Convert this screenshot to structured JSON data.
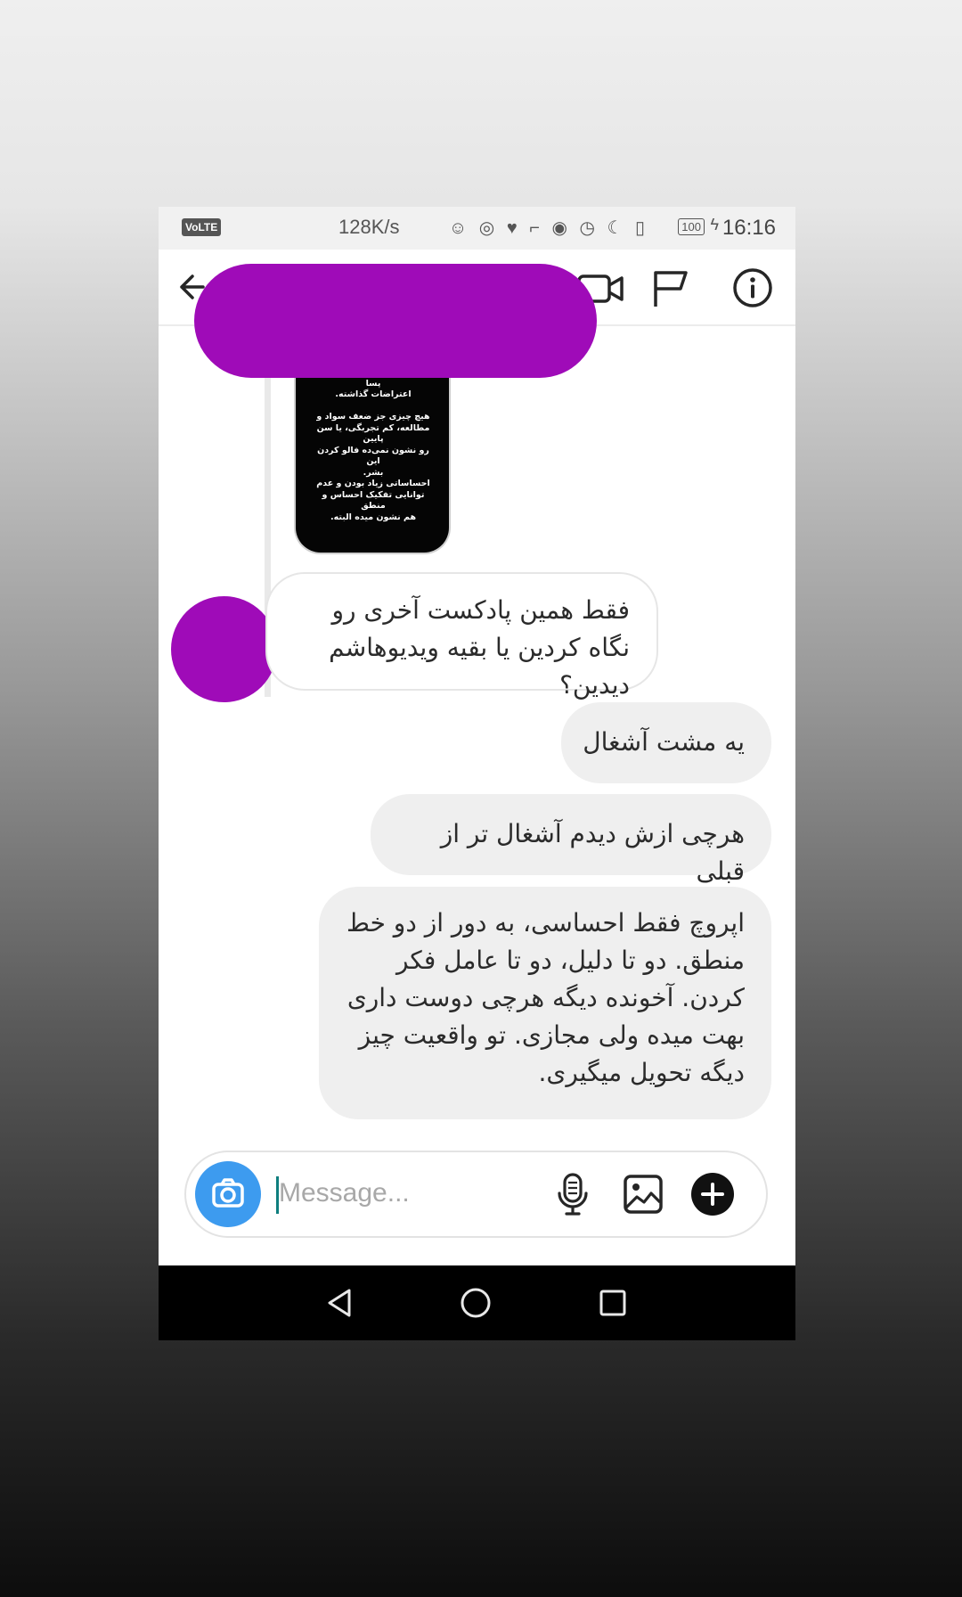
{
  "status_bar": {
    "volte": "VoLTE",
    "speed": "128K/s",
    "battery": "100",
    "time": "16:16"
  },
  "header": {
    "icons": [
      "back-arrow-icon",
      "video-call-icon",
      "flag-icon",
      "info-icon"
    ]
  },
  "story": {
    "text": "بعد استوری باز می‌کنم طرف از\nحسن آقا میری روضه خوونی پسا\nاعتراضات گذاشته.\n\nهیچ چیزی جز ضعف سواد و\nمطالعه، کم تجربگی، یا سن پایین\nرو نشون نمی‌ده فالو کردن این\nبشر.\nاحساساتی زیاد بودن و عدم\nتوانایی تفکیک احساس و منطق\nهم نشون میده البته."
  },
  "messages": {
    "received": "فقط همین پادکست آخری رو نگاه کردین یا بقیه ویدیوهاشم دیدین؟",
    "sent_1": "یه مشت آشغال",
    "sent_2": "هرچی ازش دیدم آشغال تر از قبلی",
    "sent_3": "اپروچ فقط احساسی، به دور از دو خط منطق. دو تا دلیل، دو تا عامل فکر کردن. آخونده دیگه هرچی دوست داری بهت میده ولی مجازی. تو واقعیت چیز دیگه تحویل میگیری."
  },
  "composer": {
    "placeholder": "Message...",
    "value": ""
  },
  "colors": {
    "redaction": "#9f0bb8",
    "camera_button": "#3d9bef",
    "sent_bubble": "#efefef"
  }
}
